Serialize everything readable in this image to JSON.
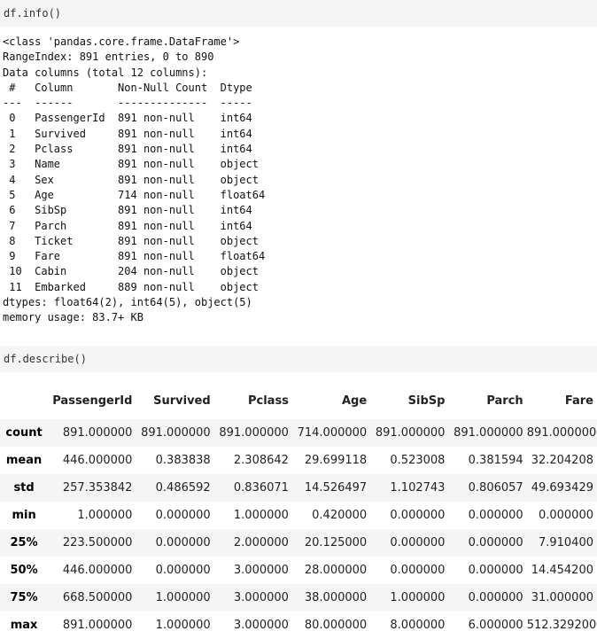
{
  "cell1": {
    "code": "df.info()"
  },
  "info": {
    "header_lines": [
      "<class 'pandas.core.frame.DataFrame'>",
      "RangeIndex: 891 entries, 0 to 890",
      "Data columns (total 12 columns):",
      " #   Column       Non-Null Count  Dtype  ",
      "---  ------       --------------  -----  "
    ],
    "rows": [
      " 0   PassengerId  891 non-null    int64  ",
      " 1   Survived     891 non-null    int64  ",
      " 2   Pclass       891 non-null    int64  ",
      " 3   Name         891 non-null    object ",
      " 4   Sex          891 non-null    object ",
      " 5   Age          714 non-null    float64",
      " 6   SibSp        891 non-null    int64  ",
      " 7   Parch        891 non-null    int64  ",
      " 8   Ticket       891 non-null    object ",
      " 9   Fare         891 non-null    float64",
      " 10  Cabin        204 non-null    object ",
      " 11  Embarked     889 non-null    object "
    ],
    "footer_lines": [
      "dtypes: float64(2), int64(5), object(5)",
      "memory usage: 83.7+ KB"
    ]
  },
  "cell2": {
    "code": "df.describe()"
  },
  "describe": {
    "columns": [
      "PassengerId",
      "Survived",
      "Pclass",
      "Age",
      "SibSp",
      "Parch",
      "Fare"
    ],
    "rows": [
      {
        "label": "count",
        "values": [
          "891.000000",
          "891.000000",
          "891.000000",
          "714.000000",
          "891.000000",
          "891.000000",
          "891.000000"
        ]
      },
      {
        "label": "mean",
        "values": [
          "446.000000",
          "0.383838",
          "2.308642",
          "29.699118",
          "0.523008",
          "0.381594",
          "32.204208"
        ]
      },
      {
        "label": "std",
        "values": [
          "257.353842",
          "0.486592",
          "0.836071",
          "14.526497",
          "1.102743",
          "0.806057",
          "49.693429"
        ]
      },
      {
        "label": "min",
        "values": [
          "1.000000",
          "0.000000",
          "1.000000",
          "0.420000",
          "0.000000",
          "0.000000",
          "0.000000"
        ]
      },
      {
        "label": "25%",
        "values": [
          "223.500000",
          "0.000000",
          "2.000000",
          "20.125000",
          "0.000000",
          "0.000000",
          "7.910400"
        ]
      },
      {
        "label": "50%",
        "values": [
          "446.000000",
          "0.000000",
          "3.000000",
          "28.000000",
          "0.000000",
          "0.000000",
          "14.454200"
        ]
      },
      {
        "label": "75%",
        "values": [
          "668.500000",
          "1.000000",
          "3.000000",
          "38.000000",
          "1.000000",
          "0.000000",
          "31.000000"
        ]
      },
      {
        "label": "max",
        "values": [
          "891.000000",
          "1.000000",
          "3.000000",
          "80.000000",
          "8.000000",
          "6.000000",
          "512.329200"
        ]
      }
    ]
  }
}
